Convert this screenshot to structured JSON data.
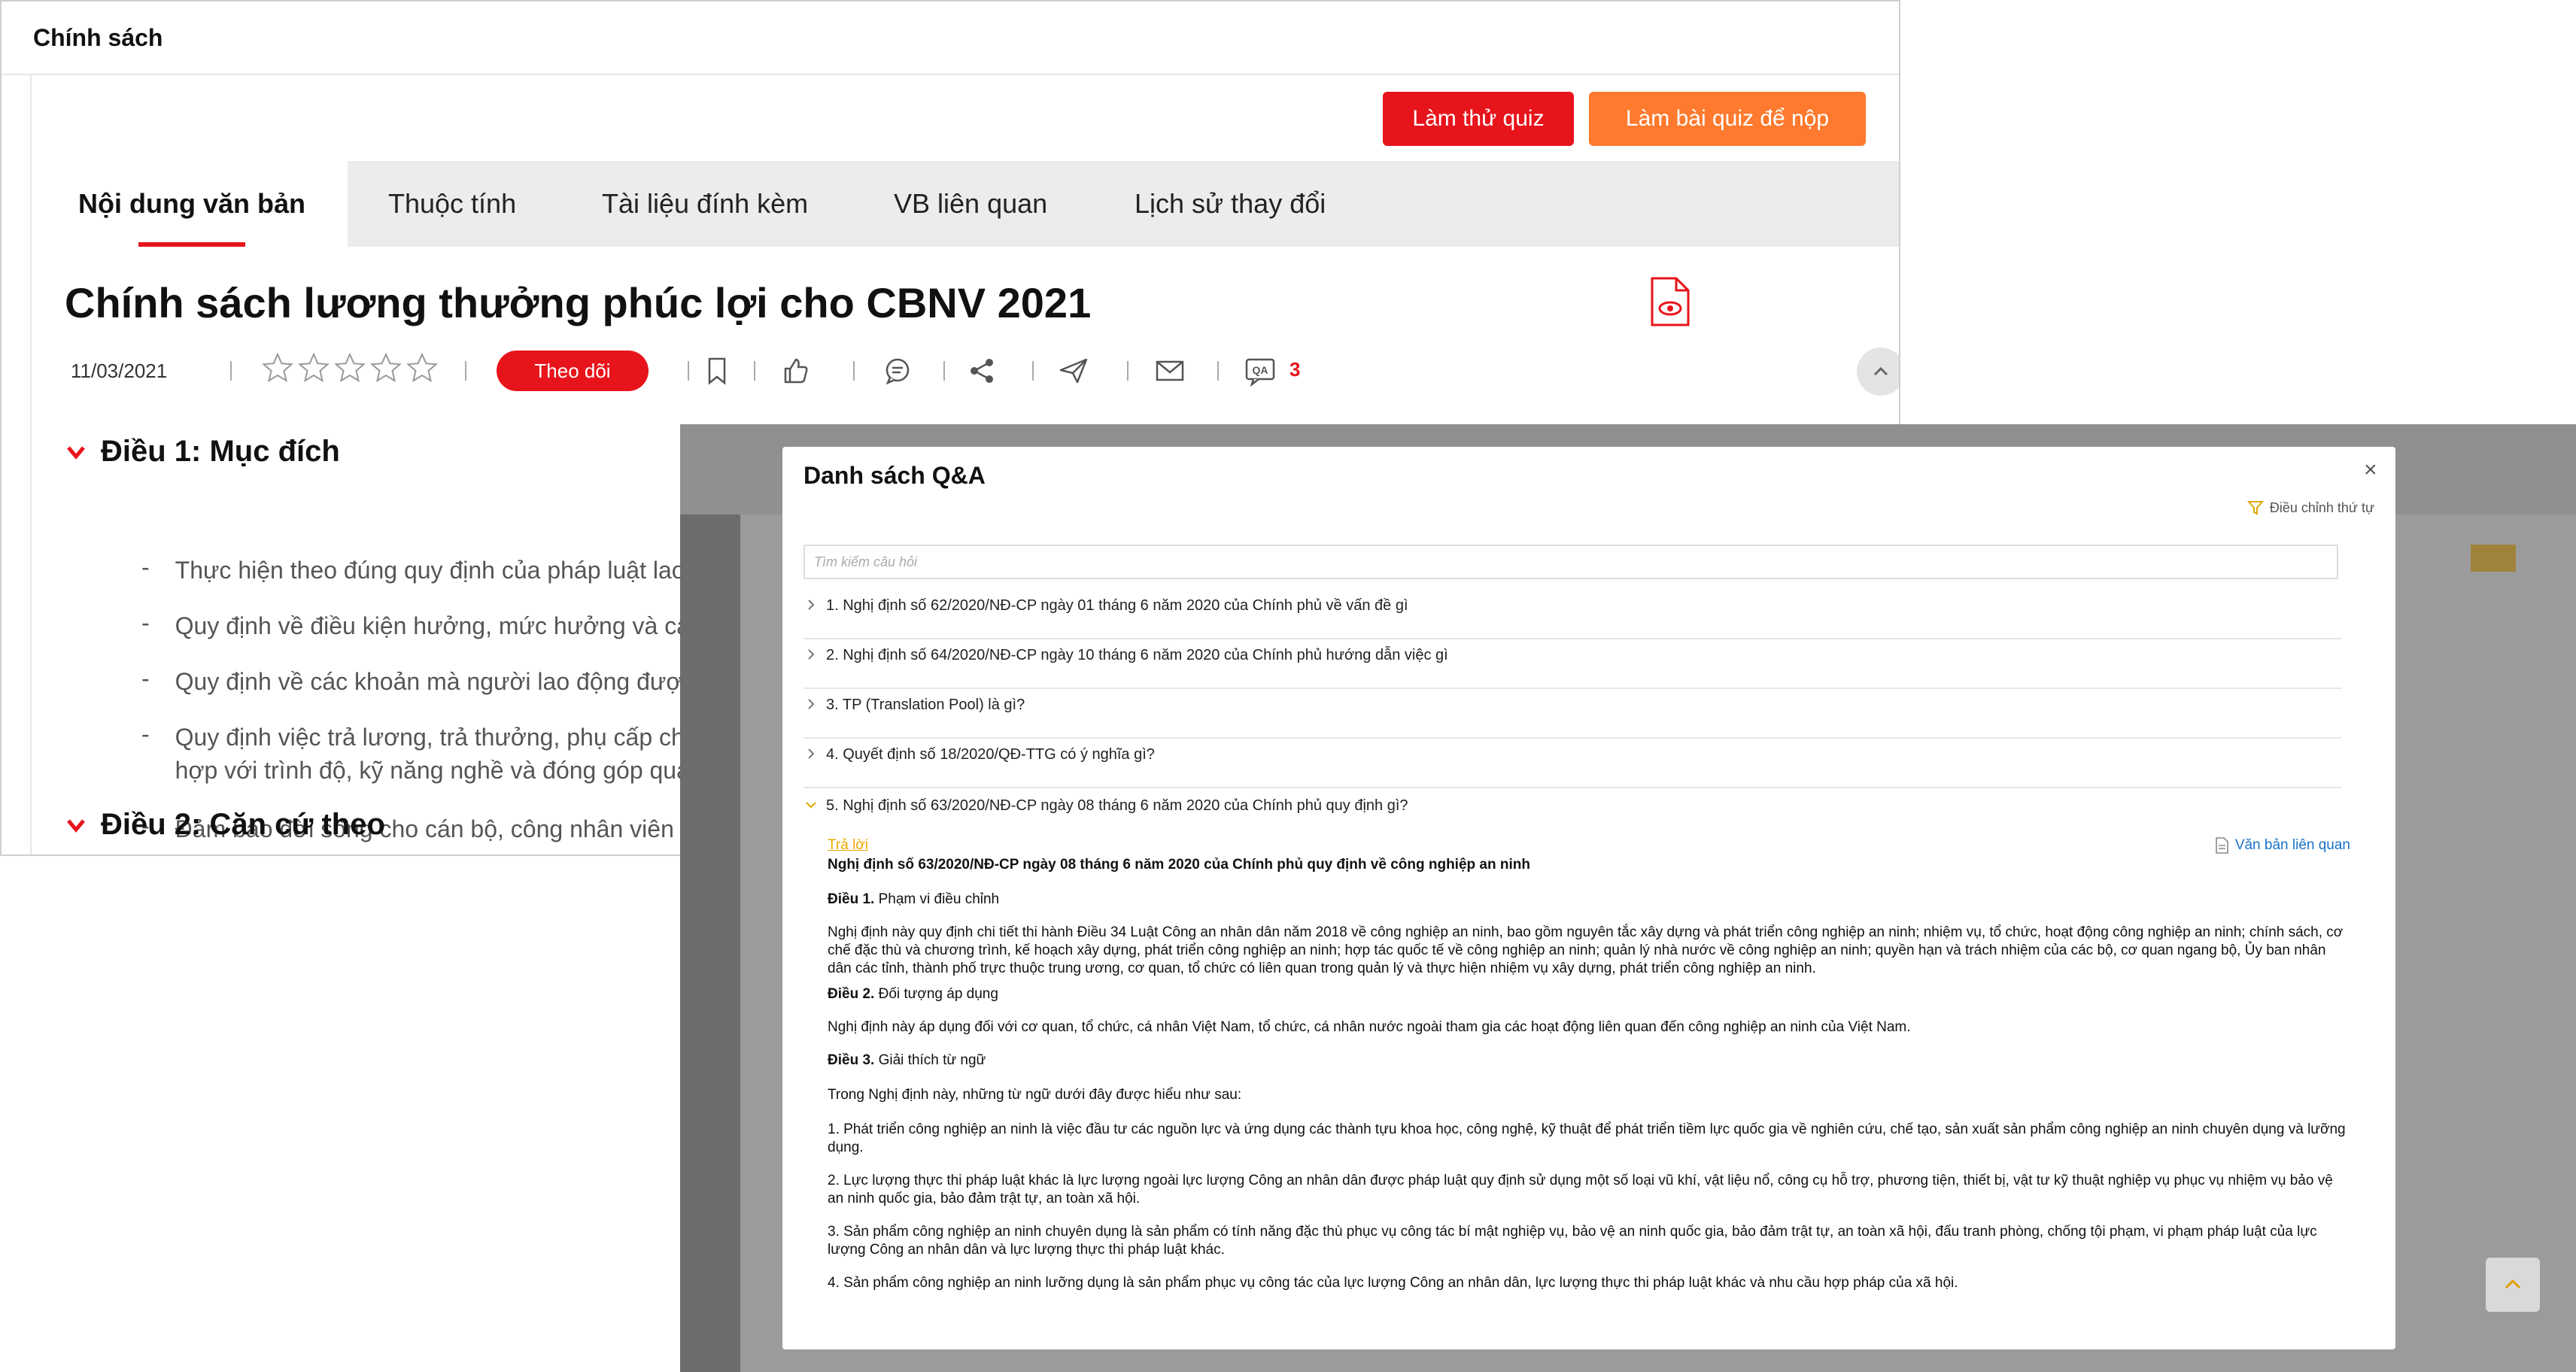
{
  "back": {
    "window_title": "Chính sách",
    "buttons": {
      "try_quiz": "Làm thử quiz",
      "submit_quiz": "Làm bài quiz để nộp"
    },
    "tabs": [
      {
        "label": "Nội dung văn bản",
        "active": true
      },
      {
        "label": "Thuộc tính"
      },
      {
        "label": "Tài liệu đính kèm"
      },
      {
        "label": "VB liên quan"
      },
      {
        "label": "Lịch sử thay đổi"
      }
    ],
    "doc_title": "Chính sách lương thưởng phúc lợi cho CBNV 2021",
    "meta": {
      "date": "11/03/2021",
      "rating_stars": 0,
      "rating_max": 5,
      "follow_label": "Theo dõi",
      "qa_count": "3",
      "icons": [
        "star-icon",
        "bookmark-icon",
        "like-icon",
        "comment-icon",
        "share-icon",
        "send-icon",
        "mail-icon",
        "qa-icon",
        "pdf-view-icon",
        "chevron-up-icon"
      ]
    },
    "sections": [
      {
        "heading": "Điều 1: Mục đích",
        "bullets": [
          "Thực hiện theo đúng quy định của pháp luật lao",
          "Quy định về điều kiện hưởng, mức hưởng và cá",
          "Quy định về các khoản mà người lao động đượ",
          "Quy định việc trả lương, trả thưởng, phụ cấp ch",
          "hợp với trình độ, kỹ năng nghề và đóng góp qua",
          "Đảm bảo đời sống cho cán bộ, công nhân viên t"
        ]
      },
      {
        "heading": "Điều 2: Căn cứ theo"
      }
    ]
  },
  "modal": {
    "title": "Danh sách Q&A",
    "close": "×",
    "sort_label": "Điều chỉnh thứ tự",
    "search_placeholder": "Tìm kiếm câu hỏi",
    "questions": [
      "1. Nghị định số 62/2020/NĐ-CP ngày 01 tháng 6 năm 2020 của Chính phủ về vấn đề gì",
      "2. Nghị định số 64/2020/NĐ-CP ngày 10 tháng 6 năm 2020 của Chính phủ hướng dẫn việc gì",
      "3. TP (Translation Pool) là gì?",
      "4. Quyết định số 18/2020/QĐ-TTG có ý nghĩa gì?",
      "5. Nghị định số 63/2020/NĐ-CP ngày 08 tháng 6 năm 2020 của Chính phủ quy định gì?"
    ],
    "expanded_index": 4,
    "answer_label": "Trả lời",
    "related_label": "Văn bản liên quan",
    "answer": {
      "heading": "Nghị định số 63/2020/NĐ-CP ngày 08 tháng 6 năm 2020 của Chính phủ quy định về công nghiệp an ninh",
      "a1_label": "Điều 1.",
      "a1_title": "Phạm vi điều chỉnh",
      "a1_body": "Nghị định này quy định chi tiết thi hành Điều 34 Luật Công an nhân dân năm 2018 về công nghiệp an ninh, bao gồm nguyên tắc xây dựng và phát triển công nghiệp an ninh; nhiệm vụ, tổ chức, hoạt động công nghiệp an ninh; chính sách, cơ chế đặc thù và chương trình, kế hoạch xây dựng, phát triển công nghiệp an ninh; hợp tác quốc tế về công nghiệp an ninh; quản lý nhà nước về công nghiệp an ninh; quyền hạn và trách nhiệm của các bộ, cơ quan ngang bộ, Ủy ban nhân dân các tỉnh, thành phố trực thuộc trung ương, cơ quan, tổ chức có liên quan trong quản lý và thực hiện nhiệm vụ xây dựng, phát triển công nghiệp an ninh.",
      "a2_label": "Điều 2.",
      "a2_title": "Đối tượng áp dụng",
      "a2_body": "Nghị định này áp dụng đối với cơ quan, tổ chức, cá nhân Việt Nam, tổ chức, cá nhân nước ngoài tham gia các hoạt động liên quan đến công nghiệp an ninh của Việt Nam.",
      "a3_label": "Điều 3.",
      "a3_title": "Giải thích từ ngữ",
      "a3_intro": "Trong Nghị định này, những từ ngữ dưới đây được hiểu như sau:",
      "d1": "1. Phát triển công nghiệp an ninh là việc đầu tư các nguồn lực và ứng dụng các thành tựu khoa học, công nghệ, kỹ thuật để phát triển tiềm lực quốc gia về nghiên cứu, chế tạo, sản xuất sản phẩm công nghiệp an ninh chuyên dụng và lưỡng dụng.",
      "d2": "2. Lực lượng thực thi pháp luật khác là lực lượng ngoài lực lượng Công an nhân dân được pháp luật quy định sử dụng một số loại vũ khí, vật liệu nổ, công cụ hỗ trợ, phương tiện, thiết bị, vật tư kỹ thuật nghiệp vụ phục vụ nhiệm vụ bảo vệ an ninh quốc gia, bảo đảm trật tự, an toàn xã hội.",
      "d3": "3. Sản phẩm công nghiệp an ninh chuyên dụng là sản phẩm có tính năng đặc thù phục vụ công tác bí mật nghiệp vụ, bảo vệ an ninh quốc gia, bảo đảm trật tự, an toàn xã hội, đấu tranh phòng, chống tội phạm, vi phạm pháp luật của lực lượng Công an nhân dân và lực lượng thực thi pháp luật khác.",
      "d4": "4. Sản phẩm công nghiệp an ninh lưỡng dụng là sản phẩm phục vụ công tác của lực lượng Công an nhân dân, lực lượng thực thi pháp luật khác và nhu cầu hợp pháp của xã hội."
    }
  },
  "colors": {
    "accent_red": "#e8141c",
    "accent_orange": "#ff7a2e",
    "answer_label": "#f0a800",
    "link_blue": "#1a73c8"
  }
}
